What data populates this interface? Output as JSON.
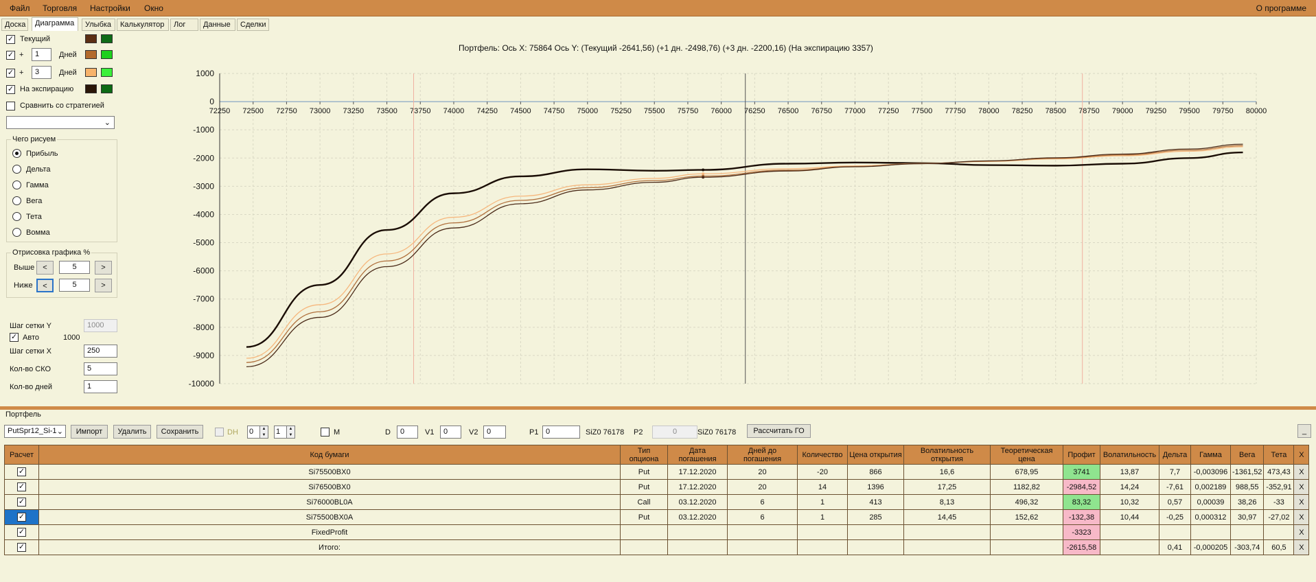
{
  "menu": {
    "file": "Файл",
    "trade": "Торговля",
    "settings": "Настройки",
    "window": "Окно",
    "about": "О программе"
  },
  "tabs": [
    "Доска",
    "Диаграмма",
    "Улыбка",
    "Калькулятор",
    "Лог",
    "Данные",
    "Сделки"
  ],
  "left": {
    "current": "Текущий",
    "plus": "+",
    "days_a_value": "1",
    "days_b_value": "3",
    "days_label": "Дней",
    "expiration": "На экспирацию",
    "compare": "Сравнить со стратегией",
    "draw_title": "Чего рисуем",
    "radios": [
      "Прибыль",
      "Дельта",
      "Гамма",
      "Вега",
      "Тета",
      "Вомма"
    ],
    "render_title": "Отрисовка графика %",
    "above": "Выше",
    "below": "Ниже",
    "prev": "<",
    "next": ">",
    "above_value": "5",
    "below_value": "5",
    "grid_y": "Шаг сетки Y",
    "grid_y_value": "1000",
    "auto": "Авто",
    "auto_value": "1000",
    "grid_x": "Шаг сетки X",
    "grid_x_value": "250",
    "sko": "Кол-во СКО",
    "sko_value": "5",
    "days_count": "Кол-во дней",
    "days_count_value": "1"
  },
  "colors": {
    "current_loss": "#5c2f14",
    "current_profit": "#0f6b17",
    "d1_loss": "#b36a2c",
    "d1_profit": "#1ed11e",
    "d3_loss": "#f7b36b",
    "d3_profit": "#3bf03b",
    "exp_loss": "#2a1608",
    "exp_profit": "#0d6a15"
  },
  "chart_data": {
    "type": "line",
    "title": "Портфель: Ось X: 75864 Ось Y:  (Текущий -2641,56)  (+1 дн. -2498,76)  (+3 дн. -2200,16)  (На экспирацию 3357)",
    "xlim": [
      72250,
      80000
    ],
    "ylim": [
      -10000,
      1000
    ],
    "xticks": [
      72250,
      72500,
      72750,
      73000,
      73250,
      73500,
      73750,
      74000,
      74250,
      74500,
      74750,
      75000,
      75250,
      75500,
      75750,
      76000,
      76250,
      76500,
      76750,
      77000,
      77250,
      77500,
      77750,
      78000,
      78250,
      78500,
      78750,
      79000,
      79250,
      79500,
      79750,
      80000
    ],
    "yticks": [
      1000,
      0,
      -1000,
      -2000,
      -3000,
      -4000,
      -5000,
      -6000,
      -7000,
      -8000,
      -9000,
      -10000
    ],
    "cursor_x": 76180,
    "sigma_lines": [
      73700,
      78700
    ],
    "marker_x": 75864,
    "series": [
      {
        "x": [
          72450,
          73000,
          73500,
          74000,
          74500,
          75000,
          75500,
          75864,
          76500,
          77000,
          77500,
          78000,
          78500,
          79000,
          79500,
          79900
        ],
        "y": [
          -8700,
          -6500,
          -4550,
          -3250,
          -2650,
          -2400,
          -2450,
          -2420,
          -2200,
          -2160,
          -2180,
          -2250,
          -2270,
          -2200,
          -2000,
          -1800
        ],
        "color": "#1a0d05",
        "width": 2.4
      },
      {
        "x": [
          72450,
          73000,
          73500,
          74000,
          74500,
          75000,
          75500,
          75864,
          76500,
          77000,
          77500,
          78000,
          78500,
          79000,
          79500,
          79900
        ],
        "y": [
          -9100,
          -7200,
          -5400,
          -4100,
          -3350,
          -2950,
          -2720,
          -2560,
          -2380,
          -2280,
          -2190,
          -2120,
          -2030,
          -1920,
          -1760,
          -1600
        ],
        "color": "#f6b77d",
        "width": 1.3
      },
      {
        "x": [
          72450,
          73000,
          73500,
          74000,
          74500,
          75000,
          75500,
          75864,
          76500,
          77000,
          77500,
          78000,
          78500,
          79000,
          79500,
          79900
        ],
        "y": [
          -9250,
          -7450,
          -5650,
          -4300,
          -3500,
          -3050,
          -2800,
          -2640,
          -2430,
          -2300,
          -2200,
          -2110,
          -2010,
          -1890,
          -1720,
          -1560
        ],
        "color": "#b0703c",
        "width": 1.3
      },
      {
        "x": [
          72450,
          73000,
          73500,
          74000,
          74500,
          75000,
          75500,
          75864,
          76500,
          77000,
          77500,
          78000,
          78500,
          79000,
          79500,
          79900
        ],
        "y": [
          -9400,
          -7650,
          -5850,
          -4480,
          -3620,
          -3130,
          -2860,
          -2680,
          -2460,
          -2310,
          -2200,
          -2100,
          -1990,
          -1860,
          -1680,
          -1510
        ],
        "color": "#4a2a18",
        "width": 1.3
      }
    ]
  },
  "portfolio": {
    "title": "Портфель",
    "select": "PutSpr12_Si-1",
    "import": "Импорт",
    "delete": "Удалить",
    "save": "Сохранить",
    "dh": "DH",
    "dh_a": "0",
    "dh_b": "1",
    "m": "M",
    "d": "D",
    "d_val": "0",
    "v1": "V1",
    "v1_val": "0",
    "v2": "V2",
    "v2_val": "0",
    "p1": "P1",
    "p1_val": "0",
    "p1_info": "SiZ0 76178",
    "p2": "P2",
    "p2_val": "0",
    "p2_info": "SiZ0 76178",
    "calc_go": "Рассчитать ГО",
    "minimize": "_"
  },
  "table": {
    "headers": [
      "Расчет",
      "Код бумаги",
      "Тип опциона",
      "Дата погашения",
      "Дней до погашения",
      "Количество",
      "Цена открытия",
      "Волатильность открытия",
      "Теоретическая цена",
      "Профит",
      "Волатильность",
      "Дельта",
      "Гамма",
      "Вега",
      "Тета",
      "X"
    ],
    "rows": [
      [
        "Si75500BX0",
        "Put",
        "17.12.2020",
        "20",
        "-20",
        "866",
        "16,6",
        "678,95",
        "3741",
        "13,87",
        "7,7",
        "-0,003096",
        "-1361,52",
        "473,43"
      ],
      [
        "Si76500BX0",
        "Put",
        "17.12.2020",
        "20",
        "14",
        "1396",
        "17,25",
        "1182,82",
        "-2984,52",
        "14,24",
        "-7,61",
        "0,002189",
        "988,55",
        "-352,91"
      ],
      [
        "Si76000BL0A",
        "Call",
        "03.12.2020",
        "6",
        "1",
        "413",
        "8,13",
        "496,32",
        "83,32",
        "10,32",
        "0,57",
        "0,00039",
        "38,26",
        "-33"
      ],
      [
        "Si75500BX0A",
        "Put",
        "03.12.2020",
        "6",
        "1",
        "285",
        "14,45",
        "152,62",
        "-132,38",
        "10,44",
        "-0,25",
        "0,000312",
        "30,97",
        "-27,02"
      ],
      [
        "FixedProfit",
        "",
        "",
        "",
        "",
        "",
        "",
        "",
        "-3323",
        "",
        "",
        "",
        "",
        ""
      ],
      [
        "Итого:",
        "",
        "",
        "",
        "",
        "",
        "",
        "",
        "-2615,58",
        "",
        "0,41",
        "-0,000205",
        "-303,74",
        "60,5"
      ]
    ]
  }
}
